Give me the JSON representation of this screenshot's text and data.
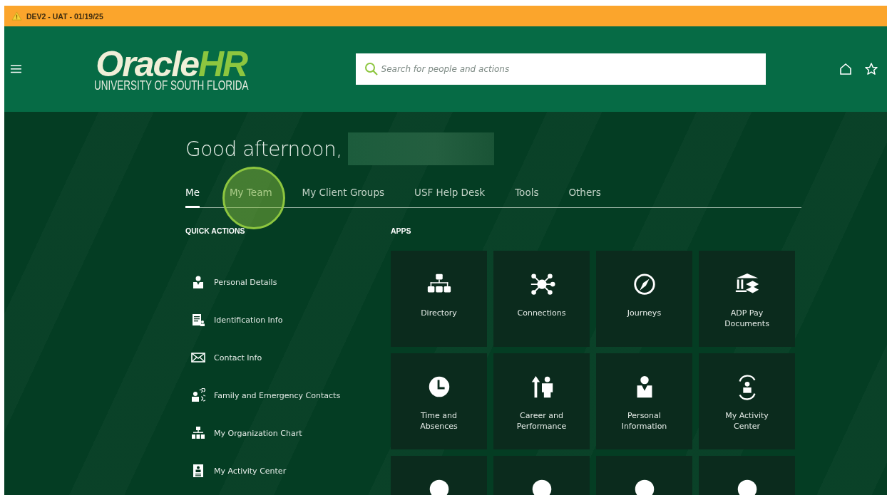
{
  "env_banner": {
    "text": "DEV2 - UAT - 01/19/25"
  },
  "header": {
    "logo": {
      "word": "Oracle",
      "accent": "HR",
      "subtitle": "UNIVERSITY OF SOUTH FLORIDA"
    },
    "search": {
      "placeholder": "Search for people and actions"
    }
  },
  "greeting": "Good afternoon,",
  "tabs": [
    {
      "label": "Me",
      "selected": true
    },
    {
      "label": "My Team",
      "selected": false
    },
    {
      "label": "My Client Groups",
      "selected": false
    },
    {
      "label": "USF Help Desk",
      "selected": false
    },
    {
      "label": "Tools",
      "selected": false
    },
    {
      "label": "Others",
      "selected": false
    }
  ],
  "quick_actions": {
    "title": "QUICK ACTIONS",
    "items": [
      {
        "label": "Personal Details"
      },
      {
        "label": "Identification Info"
      },
      {
        "label": "Contact Info"
      },
      {
        "label": "Family and Emergency Contacts"
      },
      {
        "label": "My Organization Chart"
      },
      {
        "label": "My Activity Center"
      }
    ]
  },
  "apps": {
    "title": "APPS",
    "tiles": [
      {
        "label": "Directory",
        "partial": false
      },
      {
        "label": "Connections",
        "partial": false
      },
      {
        "label": "Journeys",
        "partial": false
      },
      {
        "label": "ADP Pay Documents",
        "partial": false
      },
      {
        "label": "Time and Absences",
        "partial": false
      },
      {
        "label": "Career and Performance",
        "partial": false
      },
      {
        "label": "Personal Information",
        "partial": false
      },
      {
        "label": "My Activity Center",
        "partial": false
      },
      {
        "partial": true
      },
      {
        "partial": true
      },
      {
        "partial": true
      },
      {
        "partial": true
      }
    ]
  }
}
